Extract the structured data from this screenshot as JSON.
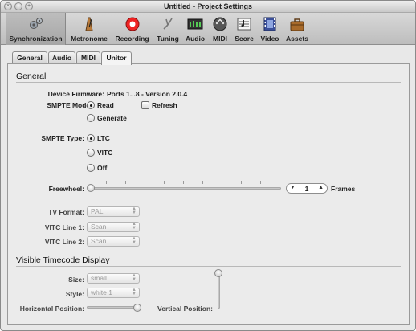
{
  "window": {
    "title": "Untitled - Project Settings"
  },
  "toolbar": {
    "items": [
      {
        "label": "Synchronization",
        "icon": "synchronization-icon"
      },
      {
        "label": "Metronome",
        "icon": "metronome-icon"
      },
      {
        "label": "Recording",
        "icon": "record-icon"
      },
      {
        "label": "Tuning",
        "icon": "tuning-fork-icon"
      },
      {
        "label": "Audio",
        "icon": "audio-icon"
      },
      {
        "label": "MIDI",
        "icon": "midi-icon"
      },
      {
        "label": "Score",
        "icon": "score-icon"
      },
      {
        "label": "Video",
        "icon": "video-icon"
      },
      {
        "label": "Assets",
        "icon": "assets-icon"
      }
    ],
    "selected": "Synchronization"
  },
  "tabs": {
    "items": [
      "General",
      "Audio",
      "MIDI",
      "Unitor"
    ],
    "selected": "Unitor"
  },
  "general": {
    "heading": "General",
    "device_firmware_label": "Device Firmware:",
    "device_firmware_value": "Ports 1...8 - Version 2.0.4",
    "smpte_mode_label": "SMPTE Mode:",
    "smpte_mode_options": [
      "Read",
      "Generate"
    ],
    "smpte_mode_selected": "Read",
    "refresh_label": "Refresh",
    "refresh_checked": false,
    "smpte_type_label": "SMPTE Type:",
    "smpte_type_options": [
      "LTC",
      "VITC",
      "Off"
    ],
    "smpte_type_selected": "LTC",
    "freewheel_label": "Freewheel:",
    "freewheel_value": "1",
    "freewheel_unit": "Frames",
    "tv_format_label": "TV Format:",
    "tv_format_value": "PAL",
    "vitc_line1_label": "VITC Line 1:",
    "vitc_line1_value": "Scan",
    "vitc_line2_label": "VITC Line 2:",
    "vitc_line2_value": "Scan"
  },
  "timecode": {
    "heading": "Visible Timecode Display",
    "size_label": "Size:",
    "size_value": "small",
    "style_label": "Style:",
    "style_value": "white 1",
    "hpos_label": "Horizontal Position:",
    "hpos_fraction": 1.0,
    "vpos_label": "Vertical Position:",
    "vpos_fraction": 1.0
  }
}
